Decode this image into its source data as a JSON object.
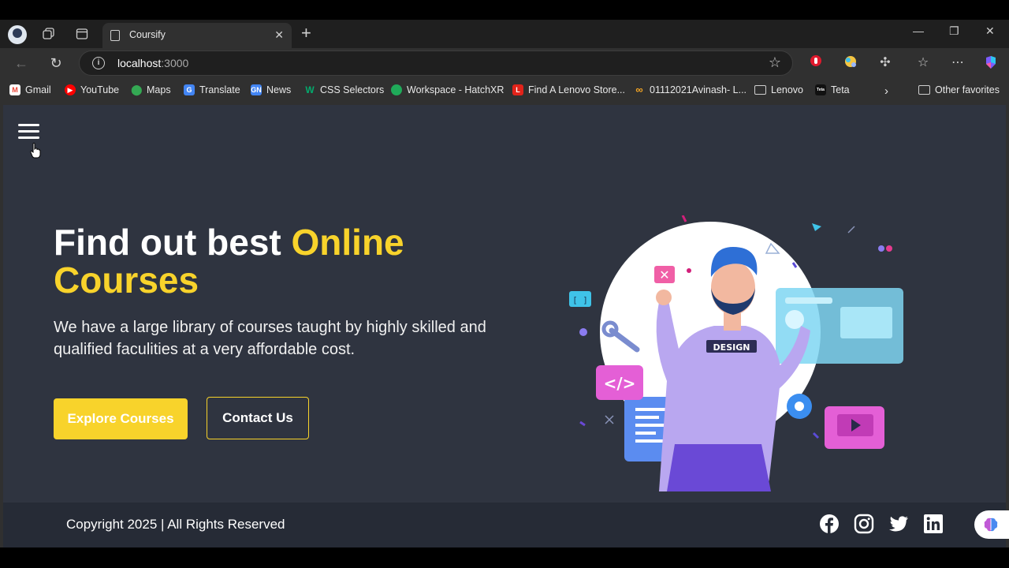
{
  "browser": {
    "tab_title": "Coursify",
    "url_host": "localhost",
    "url_port": ":3000",
    "bookmarks": [
      {
        "label": "Gmail",
        "icon": "gmail-icon",
        "color": "#ea4335"
      },
      {
        "label": "YouTube",
        "icon": "youtube-icon",
        "color": "#ff0000"
      },
      {
        "label": "Maps",
        "icon": "maps-icon",
        "color": "#34a853"
      },
      {
        "label": "Translate",
        "icon": "translate-icon",
        "color": "#4285f4"
      },
      {
        "label": "News",
        "icon": "news-icon",
        "color": "#4285f4"
      },
      {
        "label": "CSS Selectors",
        "icon": "w3schools-icon",
        "color": "#04aa6d"
      },
      {
        "label": "Workspace - HatchXR",
        "icon": "hatchxr-icon",
        "color": "#1faa59"
      },
      {
        "label": "Find A Lenovo Store...",
        "icon": "lenovo-icon",
        "color": "#e2231a"
      },
      {
        "label": "01112021Avinash- L...",
        "icon": "loop-icon",
        "color": "#f5a623"
      },
      {
        "label": "Lenovo",
        "icon": "folder-icon",
        "color": ""
      },
      {
        "label": "Teta",
        "icon": "teta-icon",
        "color": "#111111"
      }
    ],
    "other_favorites": "Other favorites",
    "teta_badge": "Teta"
  },
  "hero": {
    "title_plain": "Find out best ",
    "title_highlight": "Online Courses",
    "description": "We have a large library of courses taught by highly skilled and qualified faculities at a very affordable cost.",
    "primary_button": "Explore Courses",
    "secondary_button": "Contact Us",
    "illustration_label": "DESIGN"
  },
  "footer": {
    "copyright": "Copyright 2025 | All Rights Reserved",
    "social": [
      "facebook-icon",
      "instagram-icon",
      "twitter-icon",
      "linkedin-icon"
    ]
  },
  "colors": {
    "accent": "#f8d32b",
    "page_bg": "#2f3440",
    "footer_bg": "#262b36"
  }
}
